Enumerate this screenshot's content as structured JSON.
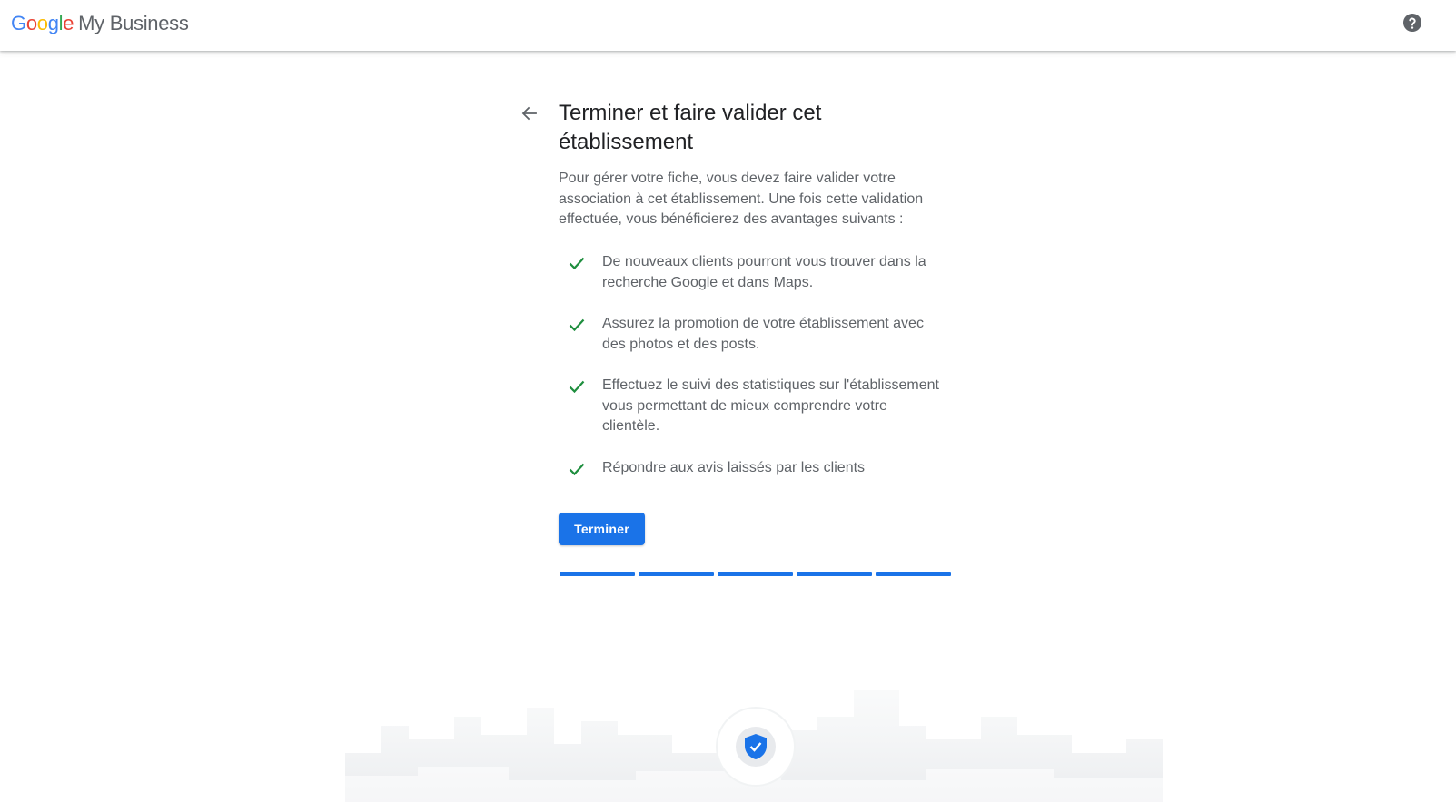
{
  "header": {
    "logo_google": "Google",
    "logo_product": "My Business",
    "help_icon": "help-circle-icon"
  },
  "page": {
    "back_icon": "arrow-back-icon",
    "title": "Terminer et faire valider cet établissement",
    "intro": "Pour gérer votre fiche, vous devez faire valider votre association à cet établissement. Une fois cette validation effectuée, vous bénéficierez des avantages suivants :",
    "benefits": [
      {
        "icon": "check-icon",
        "text": "De nouveaux clients pourront vous trouver dans la recherche Google et dans Maps."
      },
      {
        "icon": "check-icon",
        "text": "Assurez la promotion de votre établissement avec des photos et des posts."
      },
      {
        "icon": "check-icon",
        "text": "Effectuez le suivi des statistiques sur l'établissement vous permettant de mieux comprendre votre clientèle."
      },
      {
        "icon": "check-icon",
        "text": "Répondre aux avis laissés par les clients"
      }
    ],
    "finish_button": "Terminer",
    "progress": {
      "completed_steps": 5,
      "total_steps": 5
    },
    "illustration_icon": "verified-shield-icon"
  },
  "colors": {
    "accent": "#1a73e8",
    "check": "#1e8e3e",
    "text_primary": "#202124",
    "text_secondary": "#5f6368"
  }
}
